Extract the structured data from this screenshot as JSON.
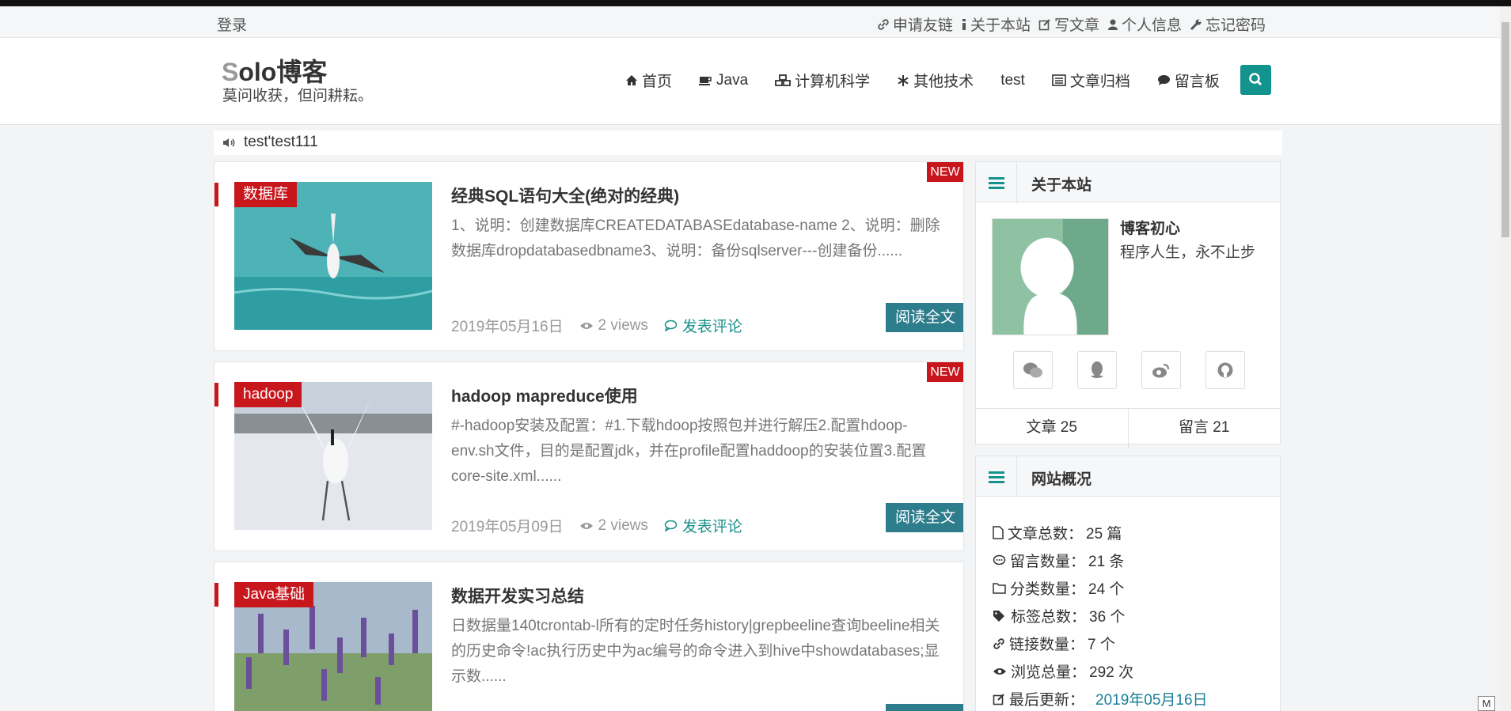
{
  "topbar": {
    "login": "登录",
    "links": [
      {
        "label": "申请友链",
        "icon": "link-icon"
      },
      {
        "label": "关于本站",
        "icon": "info-icon"
      },
      {
        "label": "写文章",
        "icon": "edit-icon"
      },
      {
        "label": "个人信息",
        "icon": "user-icon"
      },
      {
        "label": "忘记密码",
        "icon": "wrench-icon"
      }
    ]
  },
  "header": {
    "logo_first": "S",
    "logo_rest": "olo博客",
    "tagline": "莫问收获，但问耕耘。",
    "nav": [
      {
        "label": "首页",
        "icon": "home-icon"
      },
      {
        "label": "Java",
        "icon": "coffee-icon"
      },
      {
        "label": "计算机科学",
        "icon": "cubes-icon"
      },
      {
        "label": "其他技术",
        "icon": "snowflake-icon"
      },
      {
        "label": "test",
        "icon": ""
      },
      {
        "label": "文章归档",
        "icon": "list-alt-icon"
      },
      {
        "label": "留言板",
        "icon": "comment-icon"
      }
    ],
    "search_icon": "search-icon"
  },
  "notice": {
    "text": "test'test111",
    "icon": "volume-icon"
  },
  "posts": [
    {
      "category": "数据库",
      "new_badge": "NEW",
      "title": "经典SQL语句大全(绝对的经典)",
      "excerpt": " 1、说明：创建数据库CREATEDATABASEdatabase-name 2、说明：删除数据库dropdatabasedbname3、说明：备份sqlserver---创建备份......",
      "date": "2019年05月16日",
      "views": "2 views",
      "comment": "发表评论",
      "read_more": "阅读全文",
      "thumb_colors": [
        "#4fb3b8",
        "#2a9aa0"
      ]
    },
    {
      "category": "hadoop",
      "new_badge": "NEW",
      "title": "hadoop mapreduce使用",
      "excerpt": "#-hadoop安装及配置：#1.下载hdoop按照包并进行解压2.配置hdoop-env.sh文件，目的是配置jdk，并在profile配置haddoop的安装位置3.配置core-site.xml......",
      "date": "2019年05月09日",
      "views": "2 views",
      "comment": "发表评论",
      "read_more": "阅读全文",
      "thumb_colors": [
        "#bcc6d3",
        "#e7ebf0"
      ]
    },
    {
      "category": "Java基础",
      "new_badge": "",
      "title": "数据开发实习总结",
      "excerpt": "日数据量140tcrontab-l所有的定时任务history|grepbeeline查询beeline相关的历史命令!ac执行历史中为ac编号的命令进入到hive中showdatabases;显示数......",
      "date": "",
      "views": "",
      "comment": "",
      "read_more": "",
      "thumb_colors": [
        "#9fb2c9",
        "#7a9a5a"
      ]
    }
  ],
  "about": {
    "title": "关于本站",
    "author": "博客初心",
    "motto": "程序人生，永不止步",
    "social": [
      "wechat-icon",
      "qq-icon",
      "weibo-icon",
      "github-icon"
    ],
    "articles": "文章 25",
    "messages": "留言 21"
  },
  "overview": {
    "title": "网站概况",
    "rows": [
      {
        "label": "文章总数：",
        "value": "25 篇",
        "icon": "file-icon"
      },
      {
        "label": "留言数量：",
        "value": "21 条",
        "icon": "comment-dots-icon"
      },
      {
        "label": "分类数量：",
        "value": "24 个",
        "icon": "folder-icon"
      },
      {
        "label": "标签总数：",
        "value": "36 个",
        "icon": "tags-icon"
      },
      {
        "label": "链接数量：",
        "value": "7 个",
        "icon": "link-icon"
      },
      {
        "label": "浏览总量：",
        "value": "292 次",
        "icon": "eye-icon"
      }
    ],
    "last_update_label": "最后更新：",
    "last_update_value": "2019年05月16日"
  },
  "corner_label": "M",
  "colors": {
    "brand": "#13938d",
    "accent_red": "#c8161d",
    "read_button": "#2e7d8c",
    "link": "#1a8f8a"
  }
}
